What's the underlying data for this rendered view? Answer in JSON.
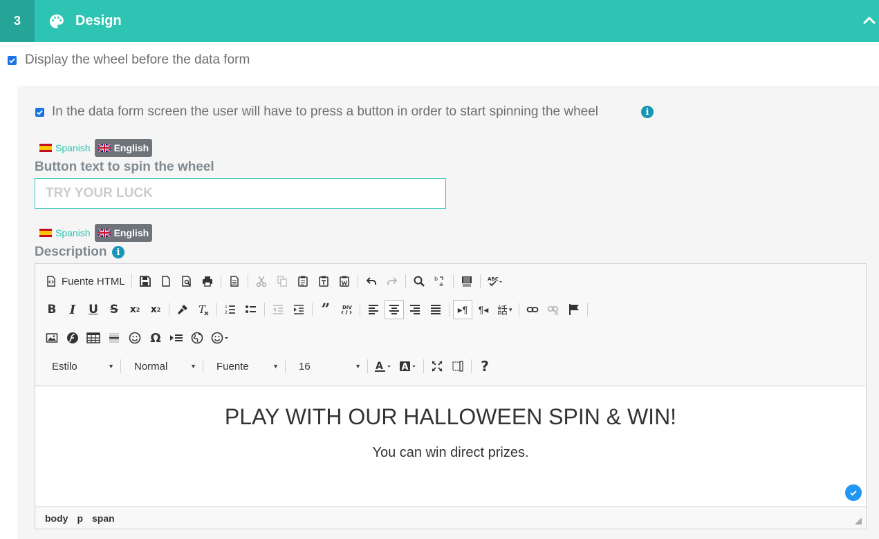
{
  "header": {
    "step": "3",
    "title": "Design"
  },
  "display_wheel": {
    "label": "Display the wheel before the data form",
    "checked": true
  },
  "press_button": {
    "label": "In the data form screen the user will have to press a button in order to start spinning the wheel",
    "checked": true
  },
  "button_text": {
    "lang_tabs": {
      "spanish": "Spanish",
      "english": "English",
      "active": "English"
    },
    "label": "Button text to spin the wheel",
    "placeholder": "TRY YOUR LUCK",
    "value": ""
  },
  "description": {
    "lang_tabs": {
      "spanish": "Spanish",
      "english": "English",
      "active": "English"
    },
    "label": "Description"
  },
  "editor": {
    "source_label": "Fuente HTML",
    "combos": {
      "style": "Estilo",
      "format": "Normal",
      "font": "Fuente",
      "size": "16"
    },
    "help": "?",
    "content_title": "PLAY WITH OUR HALLOWEEN SPIN & WIN!",
    "content_subtitle": "You can win direct prizes.",
    "path": [
      "body",
      "p",
      "span"
    ]
  },
  "colors": {
    "accent": "#2ec4b3",
    "accent_dark": "#24a597",
    "info": "#1797b5",
    "checkbox": "#1a73e8"
  }
}
